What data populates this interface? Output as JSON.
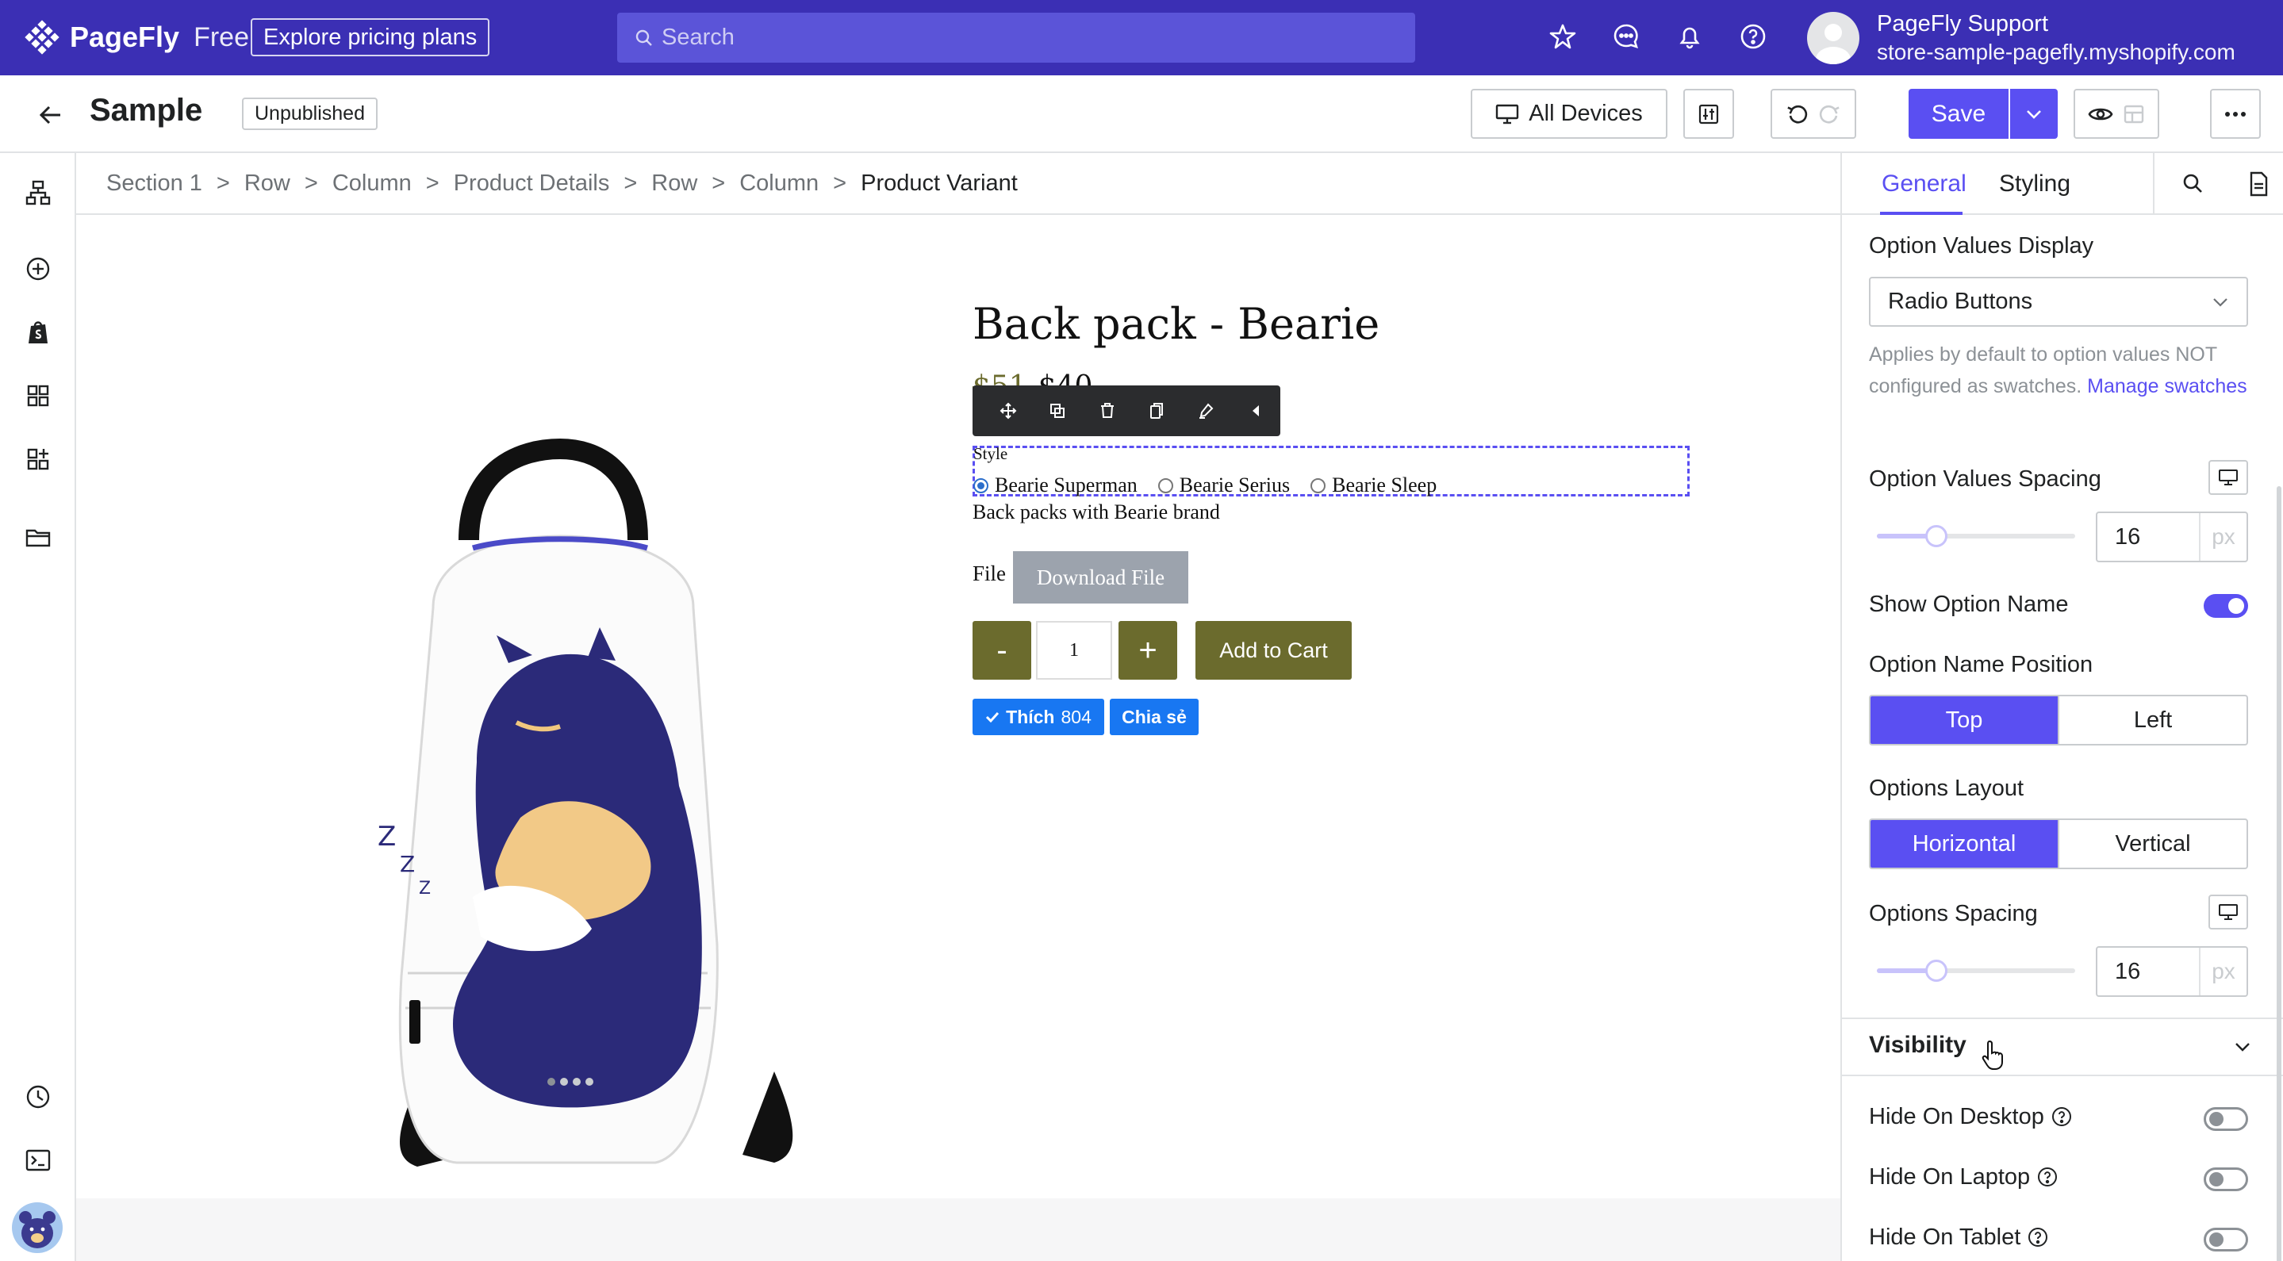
{
  "topbar": {
    "brand": "PageFly",
    "tier": "Free",
    "pricing_label": "Explore pricing plans",
    "search_placeholder": "Search",
    "user_name": "PageFly Support",
    "user_store": "store-sample-pagefly.myshopify.com"
  },
  "header": {
    "title": "Sample",
    "status": "Unpublished",
    "devices_label": "All Devices",
    "save_label": "Save"
  },
  "breadcrumb": [
    "Section 1",
    "Row",
    "Column",
    "Product Details",
    "Row",
    "Column",
    "Product Variant"
  ],
  "product": {
    "title": "Back pack - Bearie",
    "old_price": "$51",
    "price": "$40",
    "variant_label": "Style",
    "variants": [
      "Bearie Superman",
      "Bearie Serius",
      "Bearie Sleep"
    ],
    "description": "Back packs with Bearie brand",
    "file_label": "File",
    "download_label": "Download File",
    "qty_minus": "-",
    "qty_value": "1",
    "qty_plus": "+",
    "add_to_cart": "Add to Cart",
    "like_label": "Thích",
    "like_count": "804",
    "share_label": "Chia sẻ"
  },
  "panel": {
    "tabs": [
      "General",
      "Styling"
    ],
    "option_values_display_label": "Option Values Display",
    "option_values_display_value": "Radio Buttons",
    "help_text": "Applies by default to option values NOT configured as swatches.",
    "help_link": "Manage swatches",
    "option_values_spacing_label": "Option Values Spacing",
    "option_values_spacing_value": "16",
    "option_values_spacing_fraction": 0.3,
    "unit": "px",
    "show_option_name_label": "Show Option Name",
    "show_option_name": true,
    "option_name_position_label": "Option Name Position",
    "option_name_position_options": [
      "Top",
      "Left"
    ],
    "option_name_position_selected": "Top",
    "options_layout_label": "Options Layout",
    "options_layout_options": [
      "Horizontal",
      "Vertical"
    ],
    "options_layout_selected": "Horizontal",
    "options_spacing_label": "Options Spacing",
    "options_spacing_value": "16",
    "options_spacing_fraction": 0.3,
    "visibility_label": "Visibility",
    "hide_desktop_label": "Hide On Desktop",
    "hide_laptop_label": "Hide On Laptop",
    "hide_tablet_label": "Hide On Tablet"
  },
  "colors": {
    "brand": "#3b2fb4",
    "accent": "#5a4ff2",
    "olive": "#6b6b2d",
    "facebook": "#1877f2"
  },
  "icons": [
    "star-icon",
    "chat-icon",
    "bell-icon",
    "help-icon",
    "back-arrow-icon",
    "desktop-icon",
    "sliders-icon",
    "undo-icon",
    "redo-icon",
    "chevron-down-icon",
    "eye-icon",
    "more-icon",
    "search-icon",
    "page-icon"
  ]
}
